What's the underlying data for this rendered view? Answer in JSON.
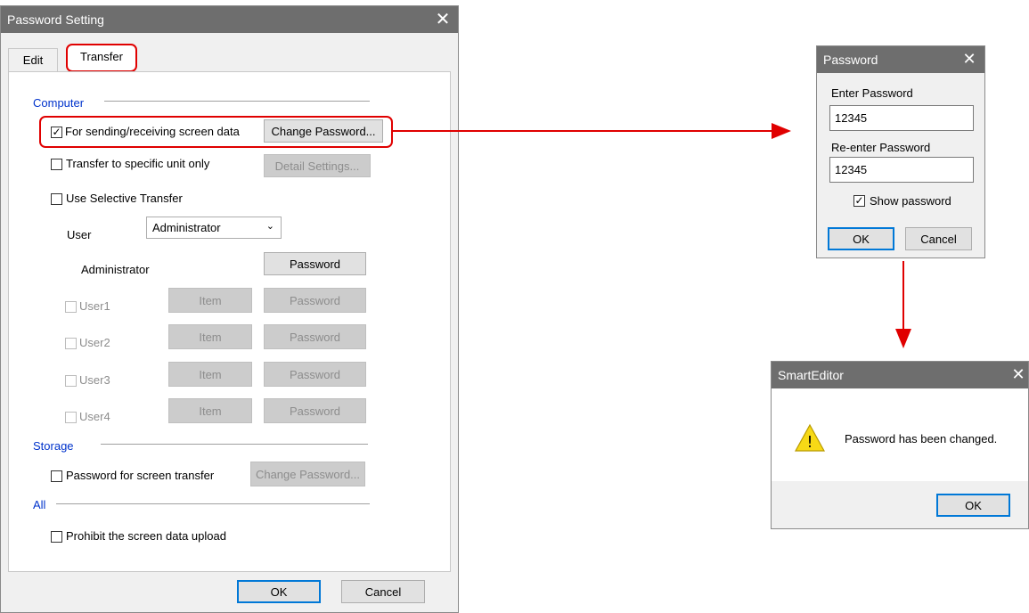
{
  "main_dialog": {
    "title": "Password Setting",
    "close_glyph": "✕",
    "tabs": [
      {
        "label": "Edit"
      },
      {
        "label": "Transfer"
      }
    ],
    "computer": {
      "group_label": "Computer",
      "sending_receiving_label": "For sending/receiving screen data",
      "sending_receiving_checked": true,
      "change_password_label": "Change Password...",
      "specific_unit_label": "Transfer to specific unit only",
      "detail_settings_label": "Detail Settings...",
      "selective_transfer_label": "Use Selective Transfer",
      "user_label": "User",
      "user_select_value": "Administrator",
      "administrator_label": "Administrator",
      "admin_password_label": "Password",
      "users": [
        {
          "name": "User1",
          "item": "Item",
          "password": "Password"
        },
        {
          "name": "User2",
          "item": "Item",
          "password": "Password"
        },
        {
          "name": "User3",
          "item": "Item",
          "password": "Password"
        },
        {
          "name": "User4",
          "item": "Item",
          "password": "Password"
        }
      ]
    },
    "storage": {
      "group_label": "Storage",
      "screen_transfer_label": "Password for screen transfer",
      "change_password_label": "Change Password..."
    },
    "all": {
      "group_label": "All",
      "prohibit_upload_label": "Prohibit the screen data upload"
    },
    "ok_label": "OK",
    "cancel_label": "Cancel"
  },
  "password_dialog": {
    "title": "Password",
    "close_glyph": "✕",
    "enter_label": "Enter Password",
    "enter_value": "12345",
    "reenter_label": "Re-enter Password",
    "reenter_value": "12345",
    "show_password_label": "Show password",
    "show_password_checked": true,
    "ok_label": "OK",
    "cancel_label": "Cancel"
  },
  "message_dialog": {
    "title": "SmartEditor",
    "close_glyph": "✕",
    "message": "Password has been changed.",
    "warning_glyph": "!",
    "ok_label": "OK"
  },
  "colors": {
    "highlight": "#e00000",
    "group_label": "#0033cc",
    "titlebar": "#6e6e6e",
    "warning": "#f7d916"
  }
}
